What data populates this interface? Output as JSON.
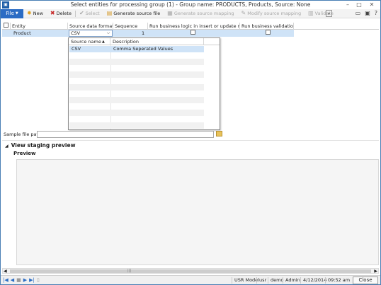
{
  "window": {
    "title": "Select entities for processing group (1) - Group name: PRODUCTS, Products, Source: None"
  },
  "toolbar": {
    "file": "File",
    "new": "New",
    "delete": "Delete",
    "select": "Select",
    "generate_source_file": "Generate source file",
    "generate_source_mapping": "Generate source mapping",
    "modify_source_mapping": "Modify source mapping",
    "validate": "Validate"
  },
  "grid": {
    "headers": [
      "Entity",
      "Source data format",
      "Sequence",
      "Run business logic in insert or update meth...",
      "Run business validations"
    ],
    "row": {
      "entity": "Product",
      "source_data_format": "CSV",
      "sequence": "1"
    }
  },
  "lookup": {
    "headers": [
      "Source name",
      "Description"
    ],
    "rows": [
      {
        "source_name": "CSV",
        "description": "Comma Seperated Values"
      }
    ]
  },
  "sample_file": {
    "label": "Sample file path:",
    "value": ""
  },
  "staging": {
    "fasttab_title": "View staging preview",
    "preview_label": "Preview"
  },
  "statusbar": {
    "model": "USR Model",
    "layer": "usr",
    "company": "demo",
    "user": "Admin",
    "date": "4/12/2014",
    "time": "09:52 am",
    "close": "Close"
  },
  "colors": {
    "accent": "#2b6cc4",
    "selection": "#cfe3f7"
  }
}
